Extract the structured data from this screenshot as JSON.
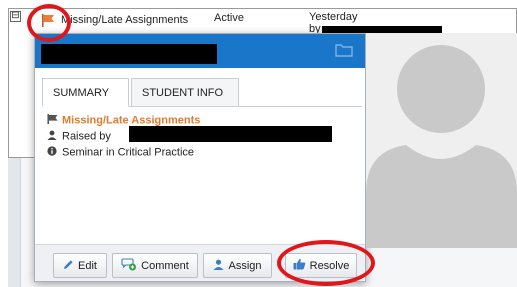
{
  "list_row": {
    "expander": "⊟",
    "title": "Missing/Late Assignments",
    "status": "Active",
    "when": "Yesterday",
    "by_label": "by"
  },
  "card": {
    "tabs": [
      {
        "label": "SUMMARY",
        "active": true
      },
      {
        "label": "STUDENT INFO",
        "active": false
      }
    ],
    "alert_type": "Missing/Late Assignments",
    "raised_by_label": "Raised by",
    "course": "Seminar in Critical Practice"
  },
  "footer": {
    "edit_label": "Edit",
    "comment_label": "Comment",
    "assign_label": "Assign",
    "resolve_label": "Resolve"
  },
  "colors": {
    "header_blue": "#1a76c8",
    "alert_orange": "#e07b2f",
    "annotation_red": "#e0161b",
    "avatar_gray": "#c9c9c9"
  }
}
